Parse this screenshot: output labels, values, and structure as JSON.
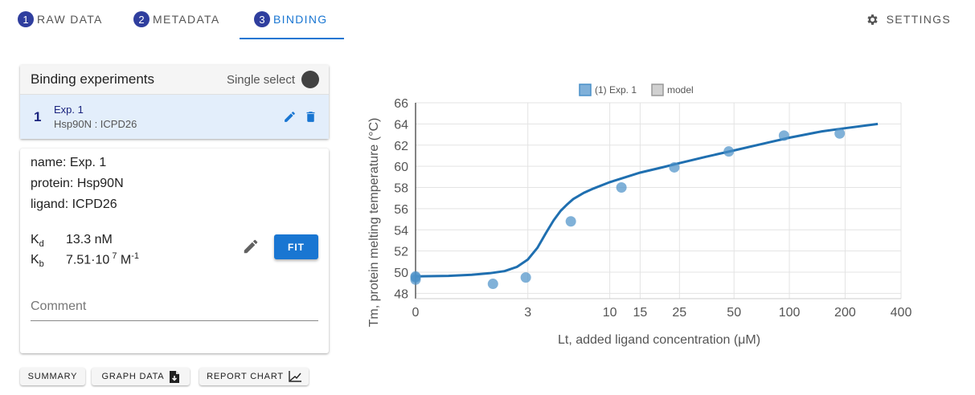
{
  "tabs": [
    {
      "num": "1",
      "label": "RAW DATA"
    },
    {
      "num": "2",
      "label": "METADATA"
    },
    {
      "num": "3",
      "label": "BINDING"
    }
  ],
  "settings_label": "SETTINGS",
  "experiments": {
    "title": "Binding experiments",
    "single_select_label": "Single select",
    "items": [
      {
        "index": "1",
        "name": "Exp. 1",
        "subtitle": "Hsp90N : ICPD26"
      }
    ]
  },
  "details": {
    "name_line": "name: Exp. 1",
    "protein_line": "protein: Hsp90N",
    "ligand_line": "ligand: ICPD26",
    "kd_symbol": "K",
    "kd_sub": "d",
    "kd_value": "13.3 nM",
    "kb_symbol": "K",
    "kb_sub": "b",
    "kb_value": "7.51·10",
    "kb_exp": " 7",
    "kb_unit": " M",
    "kb_unit_exp": "-1",
    "fit_label": "FIT",
    "comment_placeholder": "Comment"
  },
  "buttons": {
    "summary": "SUMMARY",
    "graph_data": "GRAPH DATA",
    "report_chart": "REPORT CHART"
  },
  "colors": {
    "accent": "#1976d2",
    "tab_number": "#2f3e9e",
    "series_points": "#4a90c8",
    "series_line": "#1f6fb0"
  },
  "chart_data": {
    "type": "scatter",
    "xlabel": "Lt, added ligand concentration (μM)",
    "ylabel": "Tm, protein melting temperature (°C)",
    "x_scale": "symlog",
    "x_ticks": [
      0,
      3,
      10,
      15,
      25,
      50,
      100,
      200,
      400
    ],
    "y_ticks": [
      48,
      50,
      52,
      54,
      56,
      58,
      60,
      62,
      64,
      66
    ],
    "ylim": [
      47.5,
      66
    ],
    "grid": true,
    "legend_position": "top",
    "legend": [
      "(1) Exp. 1",
      "model"
    ],
    "series": [
      {
        "name": "(1) Exp. 1",
        "x": [
          0,
          0,
          0,
          1.6,
          2.9,
          5.8,
          11.7,
          23.4,
          46.8,
          93.5,
          187
        ],
        "y": [
          49.6,
          49.5,
          49.3,
          48.9,
          49.5,
          54.8,
          58.0,
          59.9,
          61.4,
          62.9,
          63.1
        ]
      },
      {
        "name": "model",
        "x": [
          0,
          0.5,
          1,
          1.5,
          2,
          2.5,
          3,
          3.5,
          4,
          4.5,
          5,
          5.5,
          6,
          7,
          8,
          10,
          12,
          15,
          20,
          25,
          35,
          50,
          75,
          100,
          150,
          200,
          300
        ],
        "y": [
          49.6,
          49.65,
          49.75,
          49.9,
          50.1,
          50.5,
          51.2,
          52.3,
          53.7,
          54.9,
          55.8,
          56.4,
          56.9,
          57.5,
          57.9,
          58.5,
          58.9,
          59.4,
          59.9,
          60.3,
          60.9,
          61.5,
          62.2,
          62.7,
          63.3,
          63.6,
          64.0
        ]
      }
    ]
  }
}
